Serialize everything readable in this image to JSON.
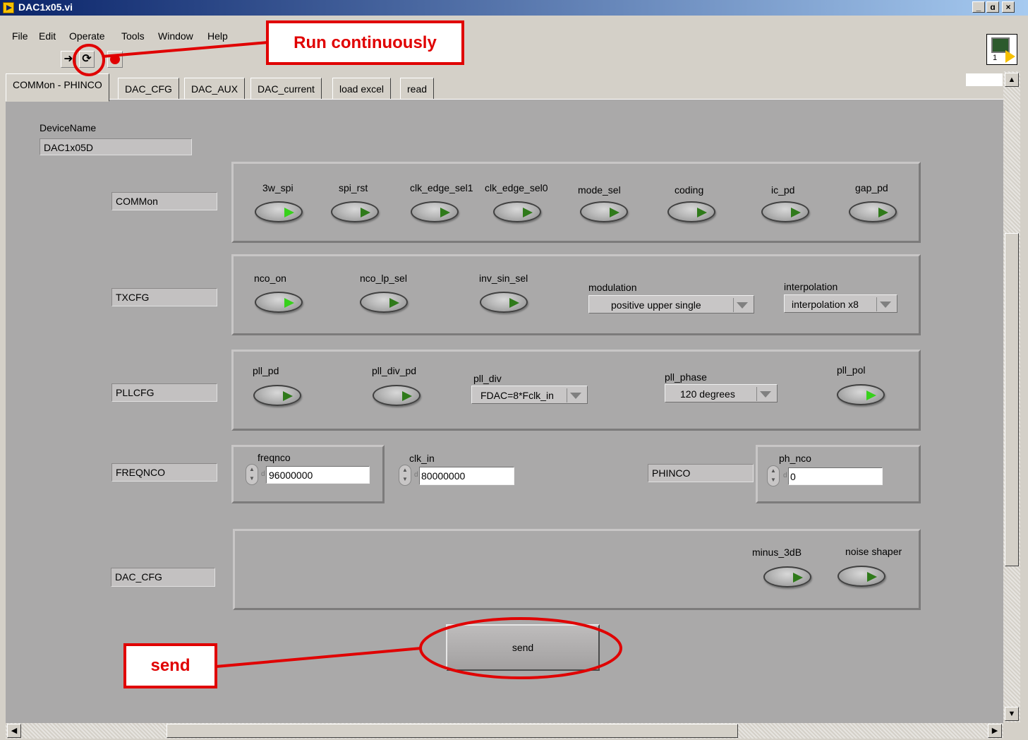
{
  "window": {
    "title": "DAC1x05.vi",
    "minimize": "_",
    "restore": "ɑ",
    "close": "×"
  },
  "menu": [
    "File",
    "Edit",
    "Operate",
    "Tools",
    "Window",
    "Help"
  ],
  "toolbar": {
    "run_icon": "arrow-run-icon",
    "run_continuously_icon": "run-continuously-icon",
    "abort_icon": "abort-stop-icon"
  },
  "vi_icon_label": "1",
  "tabs": [
    "COMMon - PHINCO",
    "DAC_CFG",
    "DAC_AUX",
    "DAC_current",
    "load excel",
    "read"
  ],
  "active_tab": 0,
  "device": {
    "label": "DeviceName",
    "value": "DAC1x05D"
  },
  "sections": {
    "common": {
      "name": "COMMon",
      "buttons": [
        {
          "label": "3w_spi",
          "on": true
        },
        {
          "label": "spi_rst",
          "on": false
        },
        {
          "label": "clk_edge_sel1",
          "on": false
        },
        {
          "label": "clk_edge_sel0",
          "on": false
        },
        {
          "label": "mode_sel",
          "on": false
        },
        {
          "label": "coding",
          "on": false
        },
        {
          "label": "ic_pd",
          "on": false
        },
        {
          "label": "gap_pd",
          "on": false
        }
      ]
    },
    "txcfg": {
      "name": "TXCFG",
      "buttons": [
        {
          "label": "nco_on",
          "on": true
        },
        {
          "label": "nco_lp_sel",
          "on": false
        },
        {
          "label": "inv_sin_sel",
          "on": false
        }
      ],
      "modulation": {
        "label": "modulation",
        "value": "positive upper single"
      },
      "interpolation": {
        "label": "interpolation",
        "value": "interpolation x8"
      }
    },
    "pllcfg": {
      "name": "PLLCFG",
      "buttons": [
        {
          "label": "pll_pd",
          "on": false
        },
        {
          "label": "pll_div_pd",
          "on": false
        },
        {
          "label": "pll_pol",
          "on": true
        }
      ],
      "pll_div": {
        "label": "pll_div",
        "value": "FDAC=8*Fclk_in"
      },
      "pll_phase": {
        "label": "pll_phase",
        "value": "120 degrees"
      }
    },
    "freqnco": {
      "name": "FREQNCO",
      "freqnco": {
        "label": "freqnco",
        "value": "96000000",
        "radix": "d"
      },
      "clk_in": {
        "label": "clk_in",
        "value": "80000000",
        "radix": "d"
      }
    },
    "phinco": {
      "name": "PHINCO",
      "ph_nco": {
        "label": "ph_nco",
        "value": "0",
        "radix": "d"
      }
    },
    "dac_cfg": {
      "name": "DAC_CFG",
      "buttons": [
        {
          "label": "minus_3dB",
          "on": false
        },
        {
          "label": "noise shaper",
          "on": false
        }
      ]
    }
  },
  "send_label": "send",
  "annotations": {
    "run_continuously": "Run continuously",
    "send": "send",
    "color": "#e00000"
  }
}
